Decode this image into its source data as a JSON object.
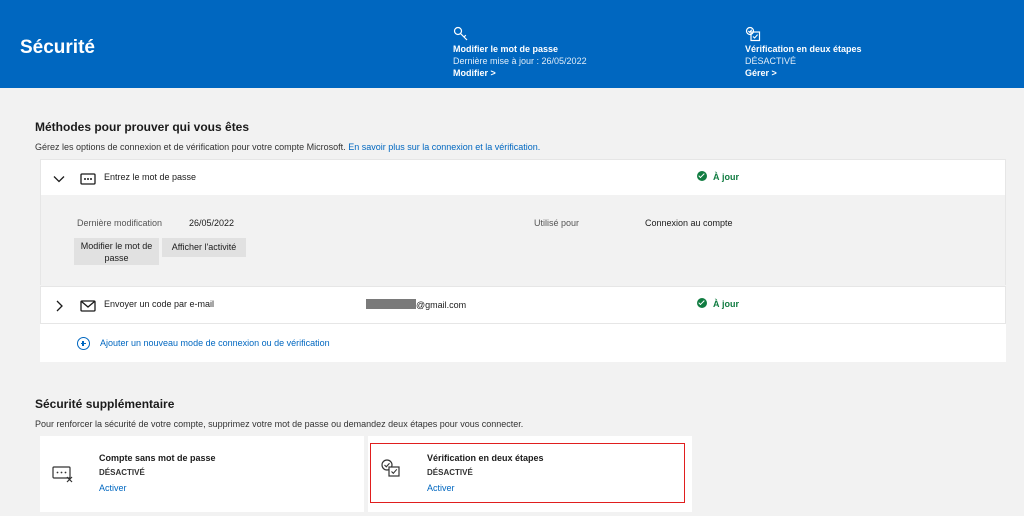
{
  "header": {
    "title": "Sécurité",
    "password_card": {
      "title": "Modifier le mot de passe",
      "subtitle": "Dernière mise à jour : 26/05/2022",
      "link": "Modifier >",
      "icon": "key-icon"
    },
    "twostep_card": {
      "title": "Vérification en deux étapes",
      "subtitle": "DÉSACTIVÉ",
      "link": "Gérer >",
      "icon": "two-step-icon"
    },
    "background_color": "#0067c0"
  },
  "methods": {
    "title": "Méthodes pour prouver qui vous êtes",
    "description": "Gérez les options de connexion et de vérification pour votre compte Microsoft.",
    "description_link": "En savoir plus sur la connexion et la vérification.",
    "password_row": {
      "label": "Entrez le mot de passe",
      "status": "À jour",
      "icon": "password-dots-icon",
      "expanded": true,
      "details": {
        "last_modified_label": "Dernière modification",
        "last_modified_value": "26/05/2022",
        "used_for_label": "Utilisé pour",
        "used_for_value": "Connexion au compte",
        "change_button": "Modifier le mot de passe",
        "activity_button": "Afficher l'activité"
      }
    },
    "email_row": {
      "label": "Envoyer un code par e-mail",
      "email_suffix": "@gmail.com",
      "status": "À jour",
      "icon": "mail-icon",
      "expanded": false
    },
    "add_method": "Ajouter un nouveau mode de connexion ou de vérification"
  },
  "extra": {
    "title": "Sécurité supplémentaire",
    "description": "Pour renforcer la sécurité de votre compte, supprimez votre mot de passe ou demandez deux étapes pour vous connecter.",
    "cards": [
      {
        "title": "Compte sans mot de passe",
        "state": "DÉSACTIVÉ",
        "link": "Activer",
        "icon": "passwordless-icon"
      },
      {
        "title": "Vérification en deux étapes",
        "state": "DÉSACTIVÉ",
        "link": "Activer",
        "icon": "two-step-icon"
      }
    ]
  },
  "colors": {
    "accent": "#0067c0",
    "success": "#107c41",
    "highlight_border": "#e01e1e"
  }
}
